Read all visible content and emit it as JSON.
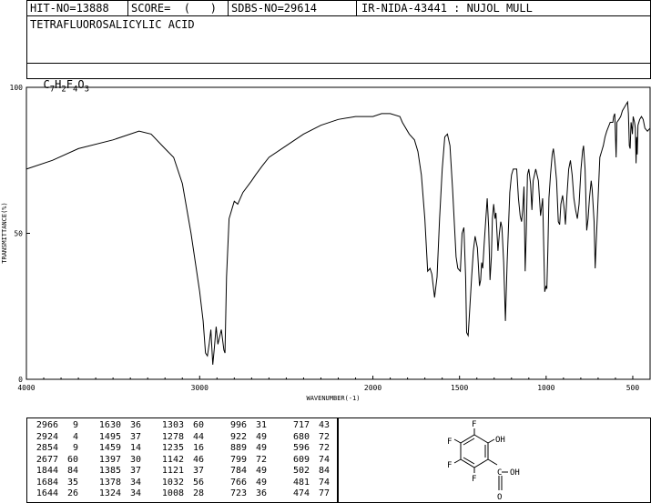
{
  "header": {
    "hit_no": "HIT-NO=13888",
    "score": "SCORE=  (   )",
    "sdbs_no": "SDBS-NO=29614",
    "ir_id": "IR-NIDA-43441 : NUJOL MULL"
  },
  "compound": {
    "name": "TETRAFLUOROSALICYLIC ACID",
    "formula": "C7H2F4O3",
    "formula_parts": {
      "c": "C",
      "c_n": "7",
      "h": "H",
      "h_n": "2",
      "f": "F",
      "f_n": "4",
      "o": "O",
      "o_n": "3"
    }
  },
  "chart_data": {
    "type": "line",
    "xlabel": "WAVENUMBER(-1)",
    "ylabel": "TRANSMITTANCE(%)",
    "xlim": [
      4000,
      400
    ],
    "ylim": [
      0,
      100
    ],
    "x_ticks": [
      4000,
      3000,
      2000,
      1500,
      1000,
      500
    ],
    "y_ticks": [
      0,
      50,
      100
    ],
    "x_tick_labels": [
      "4000",
      "3000",
      "2000",
      "1500",
      "1000",
      "500"
    ],
    "y_tick_labels": [
      "0",
      "50",
      "100"
    ],
    "series": [
      {
        "points": [
          [
            4000,
            72
          ],
          [
            3850,
            75
          ],
          [
            3700,
            79
          ],
          [
            3500,
            82
          ],
          [
            3350,
            85
          ],
          [
            3280,
            84
          ],
          [
            3200,
            79
          ],
          [
            3150,
            76
          ],
          [
            3100,
            67
          ],
          [
            3050,
            50
          ],
          [
            3000,
            30
          ],
          [
            2980,
            20
          ],
          [
            2966,
            9
          ],
          [
            2955,
            8
          ],
          [
            2945,
            12
          ],
          [
            2935,
            17
          ],
          [
            2924,
            5
          ],
          [
            2915,
            11
          ],
          [
            2905,
            18
          ],
          [
            2895,
            12
          ],
          [
            2875,
            17
          ],
          [
            2860,
            10
          ],
          [
            2854,
            9
          ],
          [
            2845,
            35
          ],
          [
            2830,
            55
          ],
          [
            2800,
            61
          ],
          [
            2780,
            60
          ],
          [
            2750,
            64
          ],
          [
            2700,
            68
          ],
          [
            2677,
            70
          ],
          [
            2640,
            73
          ],
          [
            2600,
            76
          ],
          [
            2500,
            80
          ],
          [
            2400,
            84
          ],
          [
            2300,
            87
          ],
          [
            2200,
            89
          ],
          [
            2100,
            90
          ],
          [
            2000,
            90
          ],
          [
            1950,
            91
          ],
          [
            1900,
            91
          ],
          [
            1844,
            90
          ],
          [
            1830,
            88
          ],
          [
            1790,
            84
          ],
          [
            1760,
            82
          ],
          [
            1740,
            78
          ],
          [
            1720,
            70
          ],
          [
            1700,
            55
          ],
          [
            1684,
            37
          ],
          [
            1670,
            38
          ],
          [
            1660,
            36
          ],
          [
            1644,
            28
          ],
          [
            1630,
            35
          ],
          [
            1615,
            55
          ],
          [
            1600,
            72
          ],
          [
            1585,
            83
          ],
          [
            1570,
            84
          ],
          [
            1555,
            80
          ],
          [
            1540,
            65
          ],
          [
            1520,
            42
          ],
          [
            1510,
            38
          ],
          [
            1495,
            37
          ],
          [
            1485,
            50
          ],
          [
            1475,
            52
          ],
          [
            1465,
            35
          ],
          [
            1459,
            16
          ],
          [
            1450,
            15
          ],
          [
            1440,
            25
          ],
          [
            1430,
            35
          ],
          [
            1420,
            44
          ],
          [
            1410,
            49
          ],
          [
            1397,
            45
          ],
          [
            1390,
            38
          ],
          [
            1385,
            32
          ],
          [
            1378,
            34
          ],
          [
            1372,
            40
          ],
          [
            1366,
            38
          ],
          [
            1358,
            46
          ],
          [
            1348,
            55
          ],
          [
            1340,
            62
          ],
          [
            1332,
            52
          ],
          [
            1324,
            34
          ],
          [
            1316,
            42
          ],
          [
            1310,
            55
          ],
          [
            1303,
            60
          ],
          [
            1295,
            55
          ],
          [
            1290,
            57
          ],
          [
            1278,
            44
          ],
          [
            1270,
            50
          ],
          [
            1262,
            54
          ],
          [
            1255,
            52
          ],
          [
            1245,
            40
          ],
          [
            1235,
            20
          ],
          [
            1225,
            40
          ],
          [
            1210,
            64
          ],
          [
            1200,
            70
          ],
          [
            1190,
            72
          ],
          [
            1170,
            72
          ],
          [
            1160,
            62
          ],
          [
            1150,
            56
          ],
          [
            1142,
            54
          ],
          [
            1135,
            58
          ],
          [
            1128,
            66
          ],
          [
            1121,
            37
          ],
          [
            1115,
            50
          ],
          [
            1108,
            70
          ],
          [
            1100,
            72
          ],
          [
            1090,
            67
          ],
          [
            1082,
            58
          ],
          [
            1075,
            68
          ],
          [
            1060,
            72
          ],
          [
            1045,
            68
          ],
          [
            1032,
            56
          ],
          [
            1020,
            62
          ],
          [
            1008,
            30
          ],
          [
            1000,
            32
          ],
          [
            996,
            31
          ],
          [
            990,
            44
          ],
          [
            984,
            62
          ],
          [
            975,
            70
          ],
          [
            965,
            77
          ],
          [
            958,
            79
          ],
          [
            950,
            75
          ],
          [
            940,
            68
          ],
          [
            930,
            54
          ],
          [
            922,
            53
          ],
          [
            915,
            60
          ],
          [
            905,
            63
          ],
          [
            895,
            58
          ],
          [
            889,
            53
          ],
          [
            880,
            63
          ],
          [
            870,
            72
          ],
          [
            860,
            75
          ],
          [
            850,
            70
          ],
          [
            840,
            62
          ],
          [
            830,
            58
          ],
          [
            820,
            55
          ],
          [
            810,
            60
          ],
          [
            799,
            72
          ],
          [
            790,
            78
          ],
          [
            784,
            80
          ],
          [
            775,
            72
          ],
          [
            766,
            51
          ],
          [
            758,
            55
          ],
          [
            750,
            62
          ],
          [
            740,
            68
          ],
          [
            734,
            65
          ],
          [
            723,
            54
          ],
          [
            717,
            38
          ],
          [
            710,
            48
          ],
          [
            700,
            62
          ],
          [
            690,
            76
          ],
          [
            680,
            78
          ],
          [
            670,
            80
          ],
          [
            660,
            83
          ],
          [
            650,
            85
          ],
          [
            630,
            88
          ],
          [
            615,
            88
          ],
          [
            610,
            90
          ],
          [
            604,
            91
          ],
          [
            596,
            76
          ],
          [
            592,
            88
          ],
          [
            580,
            89
          ],
          [
            570,
            90
          ],
          [
            560,
            92
          ],
          [
            550,
            93
          ],
          [
            540,
            94
          ],
          [
            530,
            95
          ],
          [
            525,
            91
          ],
          [
            520,
            80
          ],
          [
            515,
            79
          ],
          [
            510,
            88
          ],
          [
            505,
            86
          ],
          [
            502,
            84
          ],
          [
            498,
            90
          ],
          [
            490,
            88
          ],
          [
            485,
            86
          ],
          [
            481,
            74
          ],
          [
            478,
            83
          ],
          [
            474,
            77
          ],
          [
            470,
            87
          ],
          [
            460,
            89
          ],
          [
            450,
            90
          ],
          [
            440,
            89
          ],
          [
            430,
            86
          ],
          [
            415,
            85
          ],
          [
            400,
            86
          ]
        ]
      }
    ],
    "peak_table": [
      [
        {
          "w": "2966",
          "t": "9"
        },
        {
          "w": "1630",
          "t": "36"
        },
        {
          "w": "1303",
          "t": "60"
        },
        {
          "w": "996",
          "t": "31"
        },
        {
          "w": "717",
          "t": "43"
        }
      ],
      [
        {
          "w": "2924",
          "t": "4"
        },
        {
          "w": "1495",
          "t": "37"
        },
        {
          "w": "1278",
          "t": "44"
        },
        {
          "w": "922",
          "t": "49"
        },
        {
          "w": "680",
          "t": "72"
        }
      ],
      [
        {
          "w": "2854",
          "t": "9"
        },
        {
          "w": "1459",
          "t": "14"
        },
        {
          "w": "1235",
          "t": "16"
        },
        {
          "w": "889",
          "t": "49"
        },
        {
          "w": "596",
          "t": "72"
        }
      ],
      [
        {
          "w": "2677",
          "t": "60"
        },
        {
          "w": "1397",
          "t": "30"
        },
        {
          "w": "1142",
          "t": "46"
        },
        {
          "w": "799",
          "t": "72"
        },
        {
          "w": "609",
          "t": "74"
        }
      ],
      [
        {
          "w": "1844",
          "t": "84"
        },
        {
          "w": "1385",
          "t": "37"
        },
        {
          "w": "1121",
          "t": "37"
        },
        {
          "w": "784",
          "t": "49"
        },
        {
          "w": "502",
          "t": "84"
        }
      ],
      [
        {
          "w": "1684",
          "t": "35"
        },
        {
          "w": "1378",
          "t": "34"
        },
        {
          "w": "1032",
          "t": "56"
        },
        {
          "w": "766",
          "t": "49"
        },
        {
          "w": "481",
          "t": "74"
        }
      ],
      [
        {
          "w": "1644",
          "t": "26"
        },
        {
          "w": "1324",
          "t": "34"
        },
        {
          "w": "1008",
          "t": "28"
        },
        {
          "w": "723",
          "t": "36"
        },
        {
          "w": "474",
          "t": "77"
        }
      ]
    ]
  },
  "structure": {
    "atoms": {
      "f1": "F",
      "f2": "F",
      "f3": "F",
      "f4": "F",
      "oh": "OH",
      "oh2": "OH",
      "c": "C",
      "o": "O"
    }
  }
}
